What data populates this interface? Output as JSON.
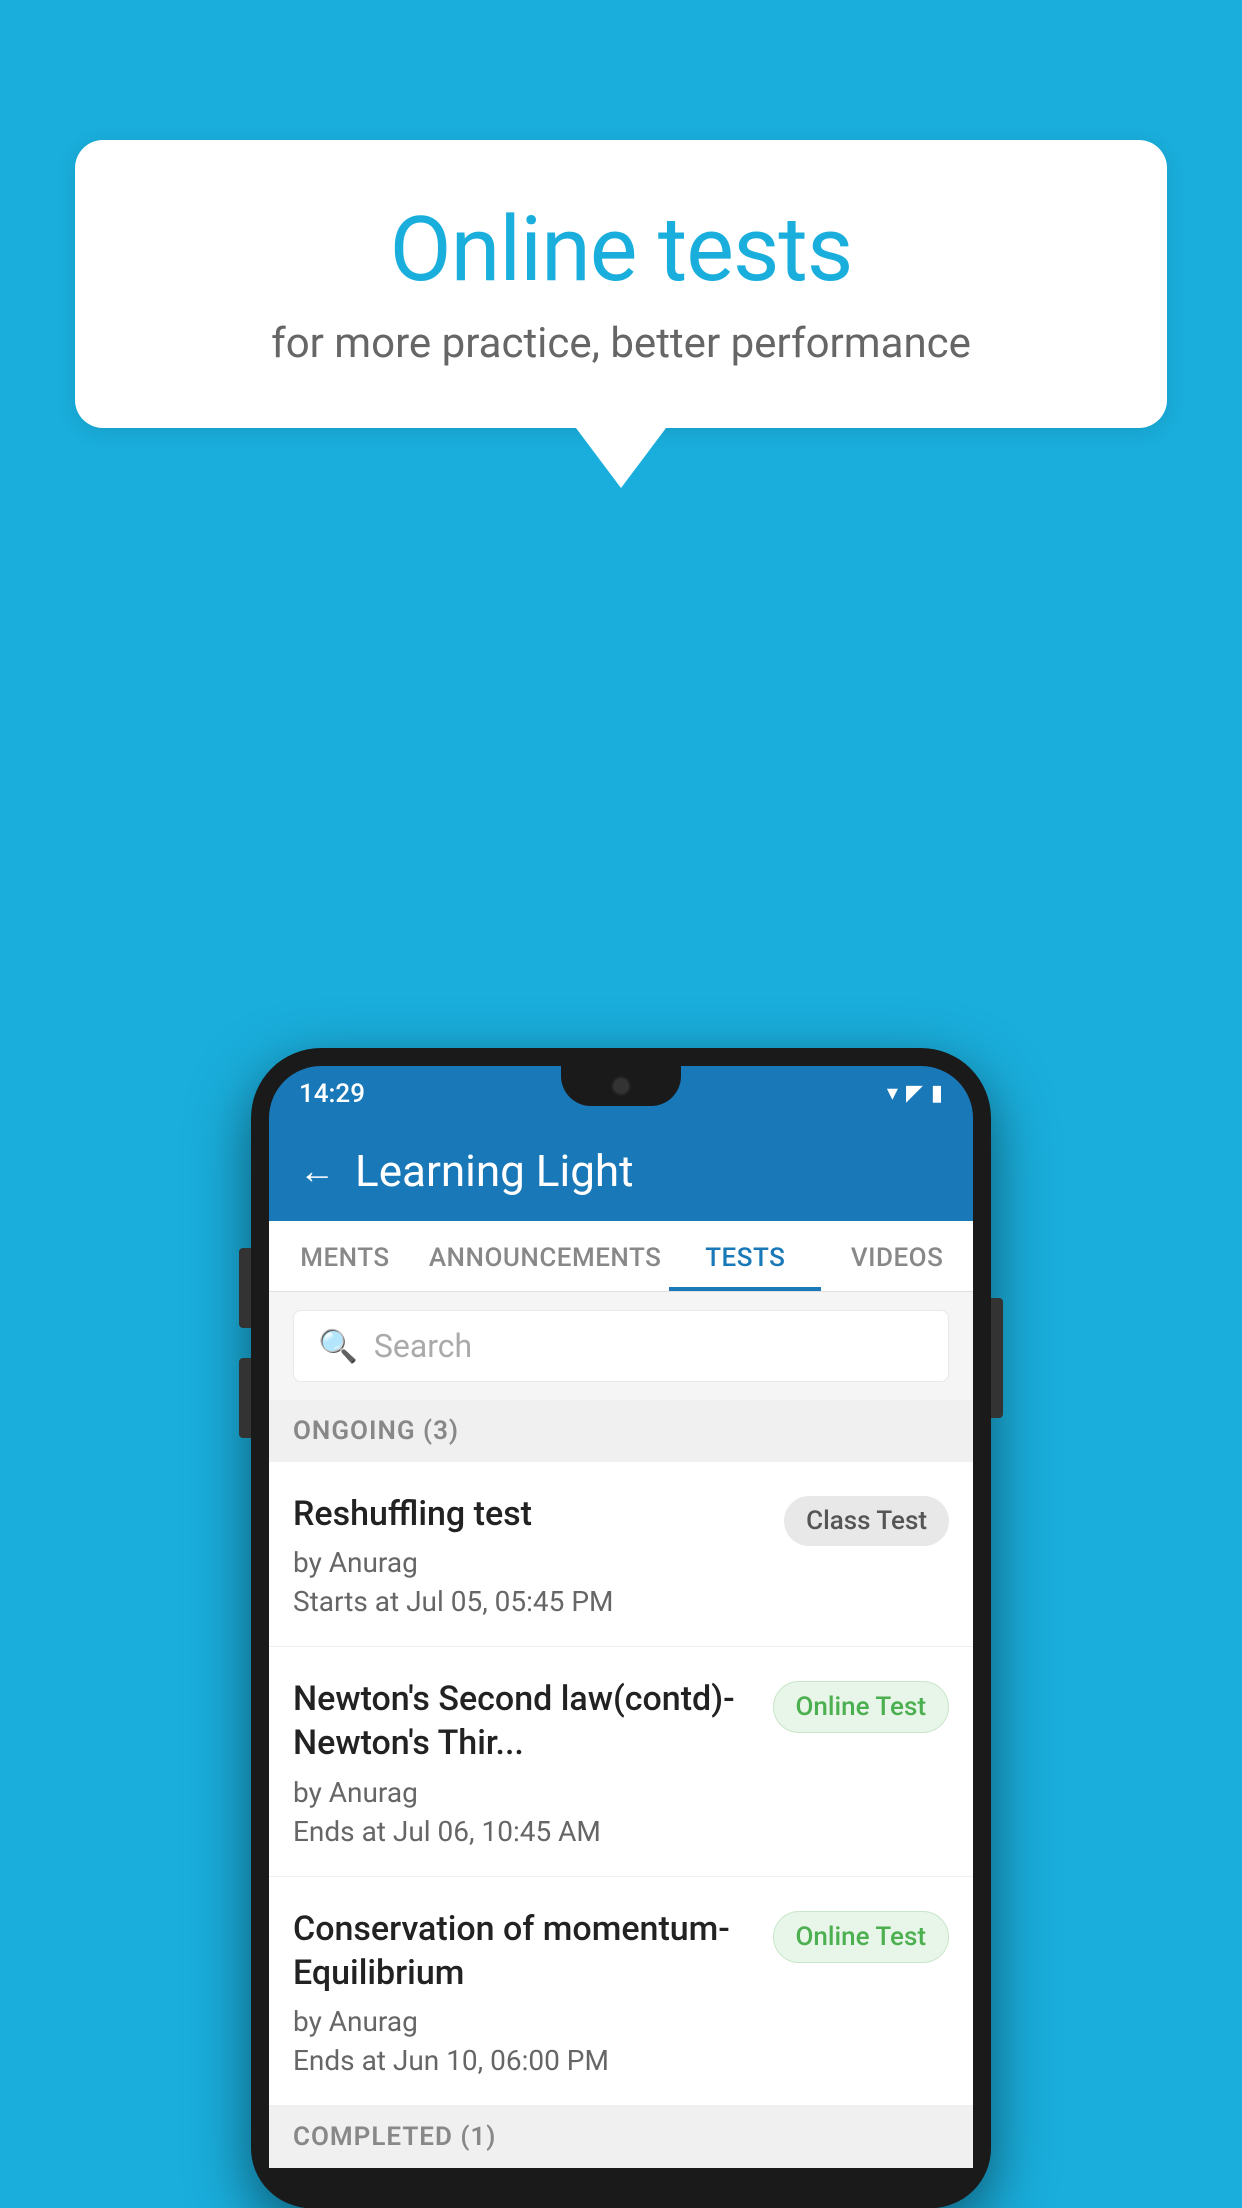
{
  "background": {
    "color": "#1AAEDC"
  },
  "speech_bubble": {
    "title": "Online tests",
    "subtitle": "for more practice, better performance"
  },
  "phone": {
    "status_bar": {
      "time": "14:29",
      "wifi": "▾",
      "signal": "▲",
      "battery": "▮"
    },
    "header": {
      "back_label": "←",
      "title": "Learning Light"
    },
    "tabs": [
      {
        "label": "MENTS",
        "active": false
      },
      {
        "label": "ANNOUNCEMENTS",
        "active": false
      },
      {
        "label": "TESTS",
        "active": true
      },
      {
        "label": "VIDEOS",
        "active": false
      }
    ],
    "search": {
      "placeholder": "Search"
    },
    "sections": [
      {
        "title": "ONGOING (3)",
        "items": [
          {
            "name": "Reshuffling test",
            "by": "by Anurag",
            "time": "Starts at  Jul 05, 05:45 PM",
            "badge": "Class Test",
            "badge_type": "class"
          },
          {
            "name": "Newton's Second law(contd)-Newton's Thir...",
            "by": "by Anurag",
            "time": "Ends at  Jul 06, 10:45 AM",
            "badge": "Online Test",
            "badge_type": "online"
          },
          {
            "name": "Conservation of momentum-Equilibrium",
            "by": "by Anurag",
            "time": "Ends at  Jun 10, 06:00 PM",
            "badge": "Online Test",
            "badge_type": "online"
          }
        ]
      },
      {
        "title": "COMPLETED (1)",
        "items": []
      }
    ]
  }
}
